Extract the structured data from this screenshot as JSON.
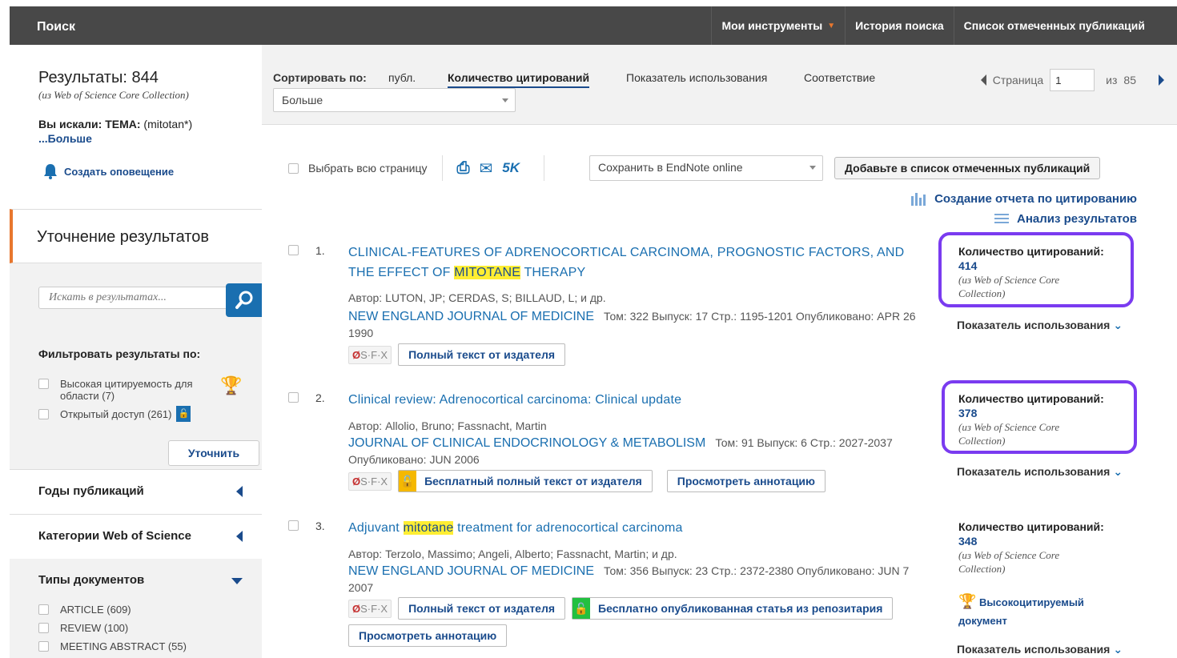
{
  "topbar": {
    "brand": "Поиск",
    "nav": [
      "Мои инструменты",
      "История поиска",
      "Список отмеченных публикаций"
    ]
  },
  "sidebar": {
    "results_title": "Результаты: 844",
    "results_source": "(из Web of Science Core Collection)",
    "searched_prefix": "Вы искали: ТЕМА:",
    "searched_query": " (mitotan*)",
    "more_link": "...Больше",
    "alert": "Создать оповещение",
    "refine_title": "Уточнение результатов",
    "search_placeholder": "Искать в результатах...",
    "filter_title": "Фильтровать результаты по:",
    "filters": [
      {
        "label": "Высокая цитируемость для области (7)"
      },
      {
        "label": "Открытый доступ (261)"
      }
    ],
    "refine_btn": "Уточнить",
    "sections": [
      "Годы публикаций",
      "Категории Web of Science"
    ],
    "doc_types_title": "Типы документов",
    "doc_types": [
      "ARTICLE (609)",
      "REVIEW (100)",
      "MEETING ABSTRACT (55)"
    ]
  },
  "sort": {
    "label": "Сортировать по:",
    "options": [
      "публ.",
      "Количество цитирований",
      "Показатель использования",
      "Соответствие"
    ],
    "more": "Больше",
    "page_label": "Страница",
    "page_value": "1",
    "of_label": "из",
    "total_pages": "85"
  },
  "toolbar": {
    "select_all": "Выбрать всю страницу",
    "count_5k": "5K",
    "save_to": "Сохранить в EndNote online",
    "add_marked": "Добавьте в список отмеченных публикаций",
    "citation_report": "Создание отчета по цитированию",
    "analyze": "Анализ результатов"
  },
  "records": [
    {
      "num": "1.",
      "title_pre": "CLINICAL-FEATURES OF ADRENOCORTICAL CARCINOMA, PROGNOSTIC FACTORS, AND THE EFFECT OF ",
      "title_hl": "MITOTANE",
      "title_post": " THERAPY",
      "authors": "Автор: LUTON, JP; CERDAS, S; BILLAUD, L; и др.",
      "journal": "NEW ENGLAND JOURNAL OF MEDICINE",
      "details": "Том: 322   Выпуск: 17   Стр.: 1195-1201   Опубликовано: APR 26 1990",
      "links": [
        "Полный текст от издателя"
      ],
      "cites_label": "Количество цитирований:",
      "cites": "414",
      "cites_src": "(из Web of Science Core Collection)",
      "usage": "Показатель использования"
    },
    {
      "num": "2.",
      "title_pre": "Clinical review: Adrenocortical carcinoma: Clinical update",
      "title_hl": "",
      "title_post": "",
      "authors": "Автор: Allolio, Bruno; Fassnacht, Martin",
      "journal": "JOURNAL OF CLINICAL ENDOCRINOLOGY & METABOLISM",
      "details": "Том: 91   Выпуск: 6   Стр.: 2027-2037   Опубликовано: JUN 2006",
      "links": [
        "Бесплатный полный текст от издателя",
        "Просмотреть аннотацию"
      ],
      "cites_label": "Количество цитирований:",
      "cites": "378",
      "cites_src": "(из Web of Science Core Collection)",
      "usage": "Показатель использования"
    },
    {
      "num": "3.",
      "title_pre": "Adjuvant ",
      "title_hl": "mitotane",
      "title_post": " treatment for adrenocortical carcinoma",
      "authors": "Автор: Terzolo, Massimo; Angeli, Alberto; Fassnacht, Martin; и др.",
      "journal": "NEW ENGLAND JOURNAL OF MEDICINE",
      "details": "Том: 356   Выпуск: 23   Стр.: 2372-2380   Опубликовано: JUN 7 2007",
      "links": [
        "Полный текст от издателя",
        "Бесплатно опубликованная статья из репозитария",
        "Просмотреть аннотацию"
      ],
      "cites_label": "Количество цитирований:",
      "cites": "348",
      "cites_src": "(из Web of Science Core Collection)",
      "hcd_line1": "Высокоцитируемый",
      "hcd_line2": "документ",
      "usage": "Показатель использования"
    }
  ],
  "sfx_label": "S·F·X",
  "colors": {
    "accent_orange": "#e8772e",
    "link_blue": "#1a4b8c",
    "highlight": "#ffee33",
    "outline": "#7a3bf0",
    "oa_gold": "#f5b800",
    "oa_green": "#22c040"
  }
}
